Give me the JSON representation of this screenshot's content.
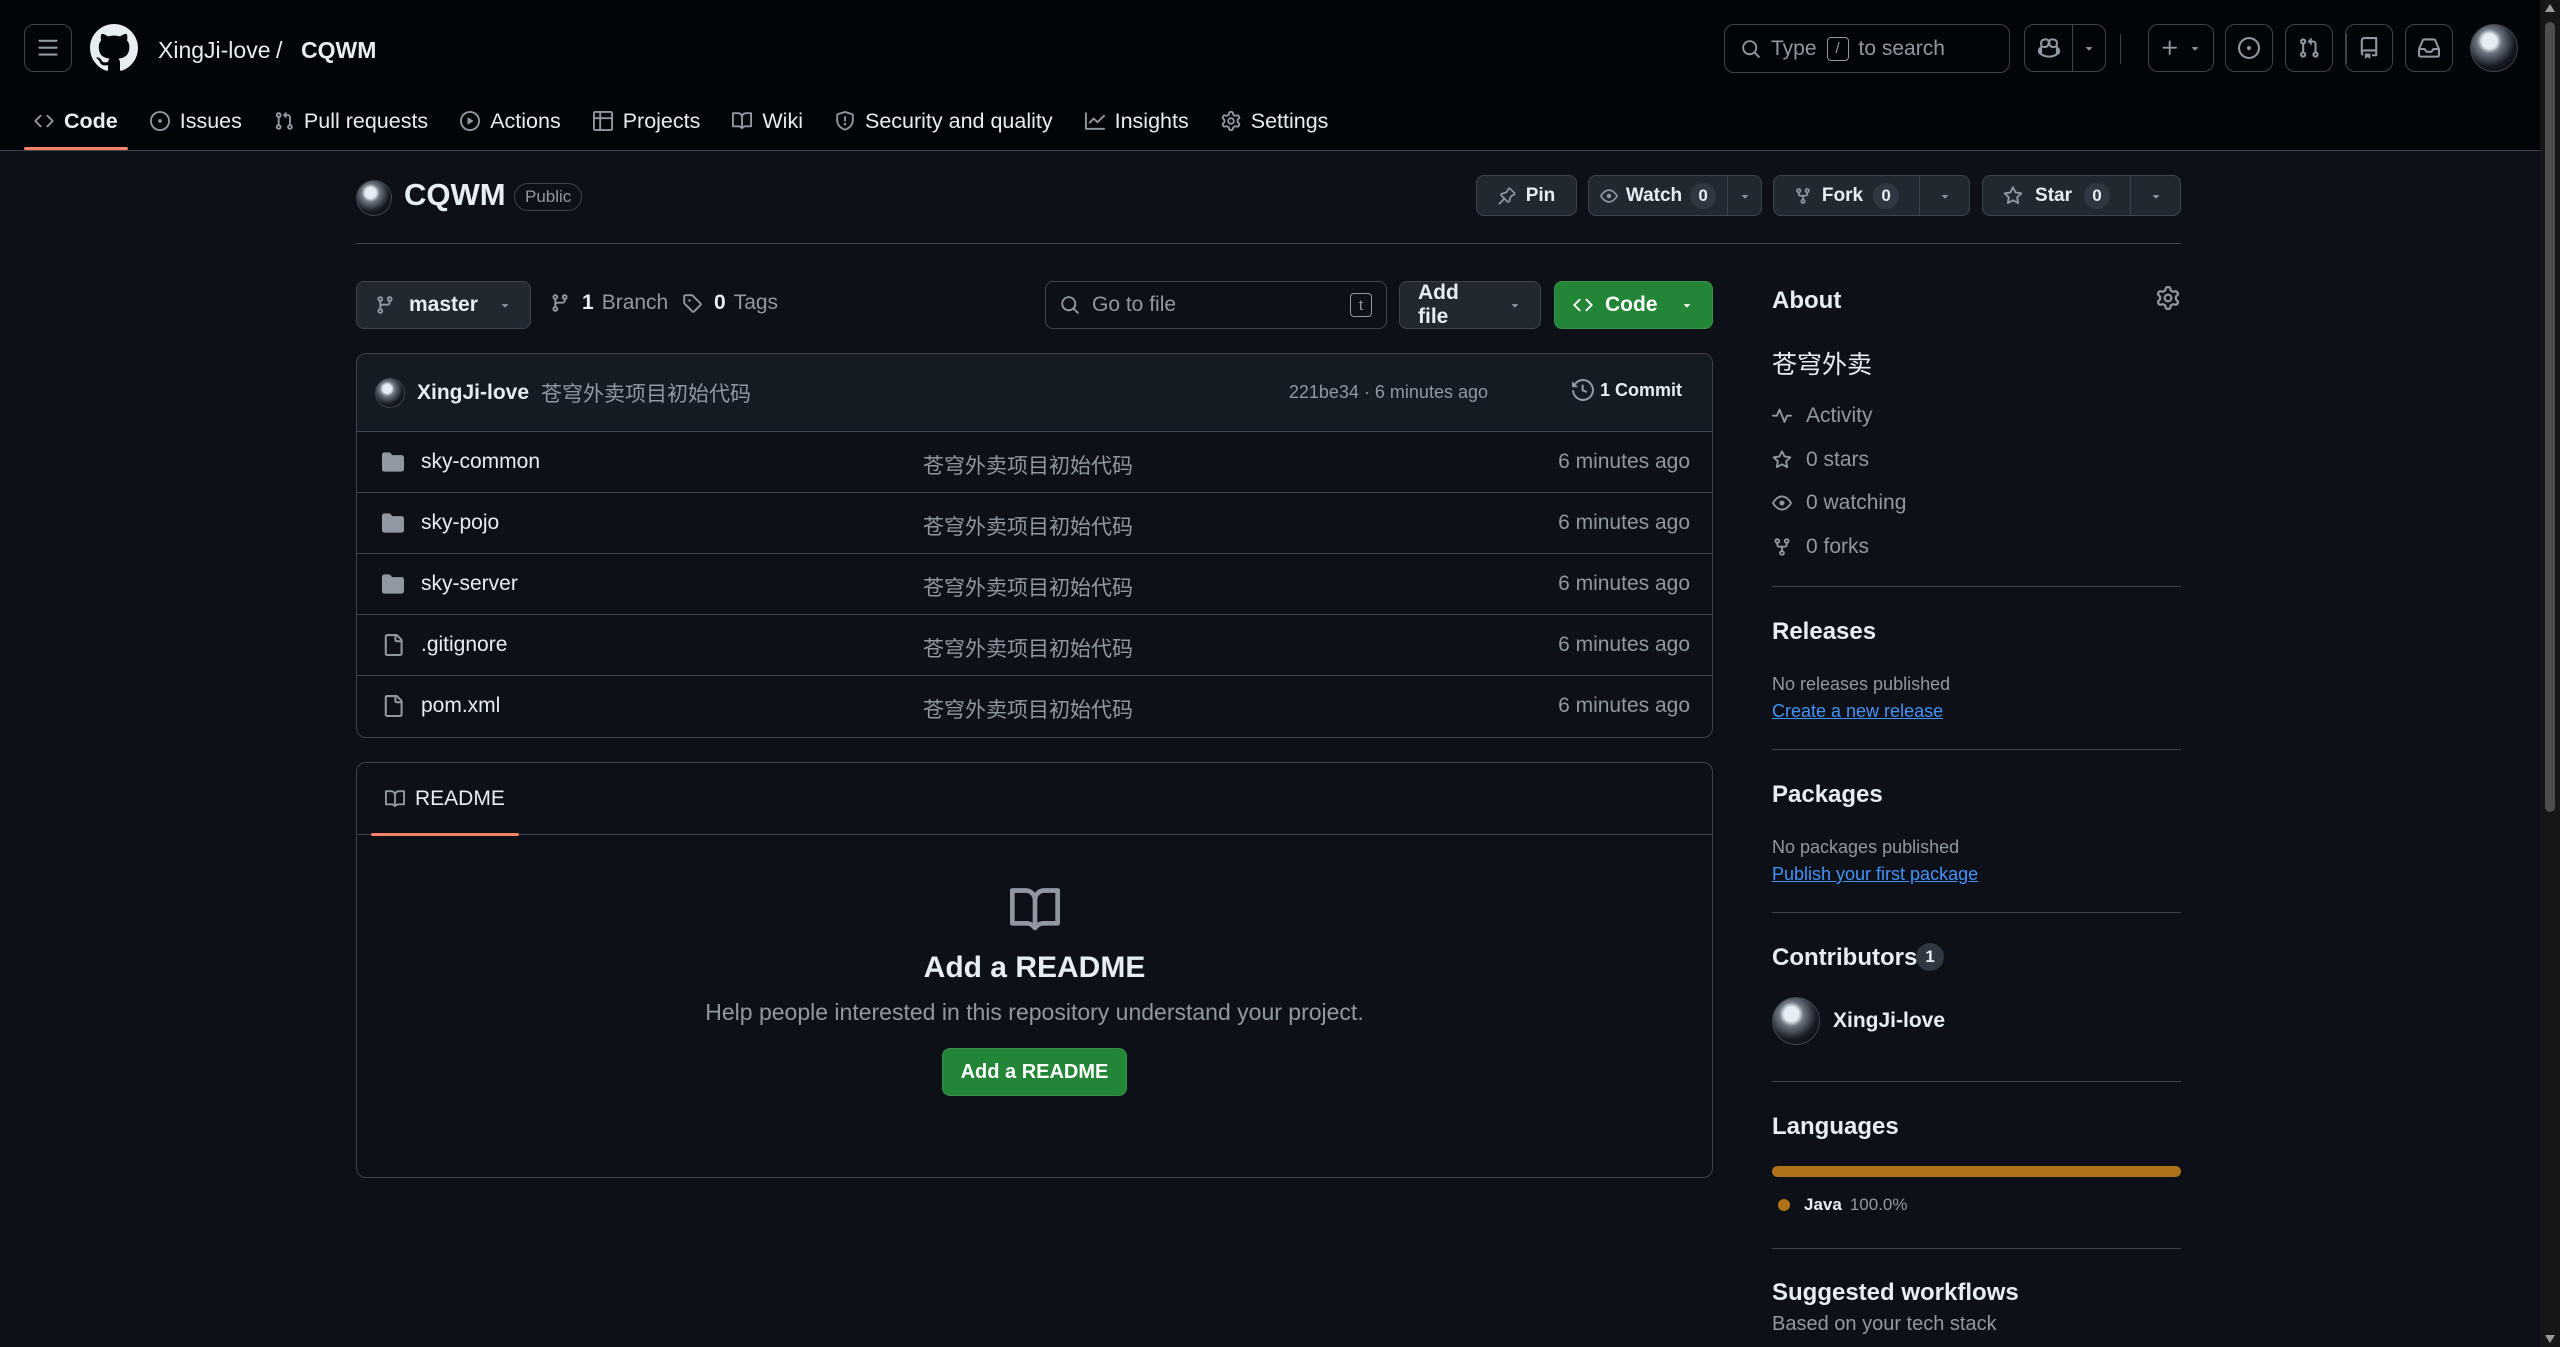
{
  "header": {
    "owner": "XingJi-love",
    "separator": "/",
    "repo": "CQWM",
    "search": {
      "prefix": "Type",
      "key": "/",
      "suffix": "to search"
    }
  },
  "nav": {
    "tabs": [
      {
        "label": "Code",
        "icon": "code-icon",
        "selected": true
      },
      {
        "label": "Issues",
        "icon": "issue-icon"
      },
      {
        "label": "Pull requests",
        "icon": "pull-request-icon"
      },
      {
        "label": "Actions",
        "icon": "play-icon"
      },
      {
        "label": "Projects",
        "icon": "table-icon"
      },
      {
        "label": "Wiki",
        "icon": "book-icon"
      },
      {
        "label": "Security and quality",
        "icon": "shield-icon"
      },
      {
        "label": "Insights",
        "icon": "graph-icon"
      },
      {
        "label": "Settings",
        "icon": "gear-icon"
      }
    ]
  },
  "repo": {
    "name": "CQWM",
    "visibility": "Public",
    "pin_label": "Pin",
    "watch_label": "Watch",
    "watch_count": "0",
    "fork_label": "Fork",
    "fork_count": "0",
    "star_label": "Star",
    "star_count": "0"
  },
  "toolbar": {
    "branch": "master",
    "branch_count": "1",
    "branch_label": "Branch",
    "tag_count": "0",
    "tag_label": "Tags",
    "goto_placeholder": "Go to file",
    "goto_key": "t",
    "add_file_label": "Add file",
    "code_label": "Code"
  },
  "commit": {
    "author": "XingJi-love",
    "message": "苍穹外卖项目初始代码",
    "sha_time": "221be34 · 6 minutes ago",
    "count_label": "1 Commit"
  },
  "files": [
    {
      "name": "sky-common",
      "type": "folder",
      "message": "苍穹外卖项目初始代码",
      "age": "6 minutes ago"
    },
    {
      "name": "sky-pojo",
      "type": "folder",
      "message": "苍穹外卖项目初始代码",
      "age": "6 minutes ago"
    },
    {
      "name": "sky-server",
      "type": "folder",
      "message": "苍穹外卖项目初始代码",
      "age": "6 minutes ago"
    },
    {
      "name": ".gitignore",
      "type": "file",
      "message": "苍穹外卖项目初始代码",
      "age": "6 minutes ago"
    },
    {
      "name": "pom.xml",
      "type": "file",
      "message": "苍穹外卖项目初始代码",
      "age": "6 minutes ago"
    }
  ],
  "readme": {
    "tab_label": "README",
    "title": "Add a README",
    "subtitle": "Help people interested in this repository understand your project.",
    "button_label": "Add a README"
  },
  "sidebar": {
    "about_title": "About",
    "description": "苍穹外卖",
    "activity": "Activity",
    "stars": "0 stars",
    "watching": "0 watching",
    "forks": "0 forks",
    "releases_title": "Releases",
    "releases_empty": "No releases published",
    "releases_link": "Create a new release",
    "packages_title": "Packages",
    "packages_empty": "No packages published",
    "packages_link": "Publish your first package",
    "contributors_title": "Contributors",
    "contributors_count": "1",
    "contributor_name": "XingJi-love",
    "languages_title": "Languages",
    "language_name": "Java",
    "language_percent": "100.0%",
    "language_fraction": 1.0,
    "language_color": "#b07219",
    "workflows_title": "Suggested workflows",
    "workflows_subtitle": "Based on your tech stack"
  },
  "colors": {
    "accent_tab": "#f78166",
    "green": "#238636",
    "link": "#4493f8"
  }
}
